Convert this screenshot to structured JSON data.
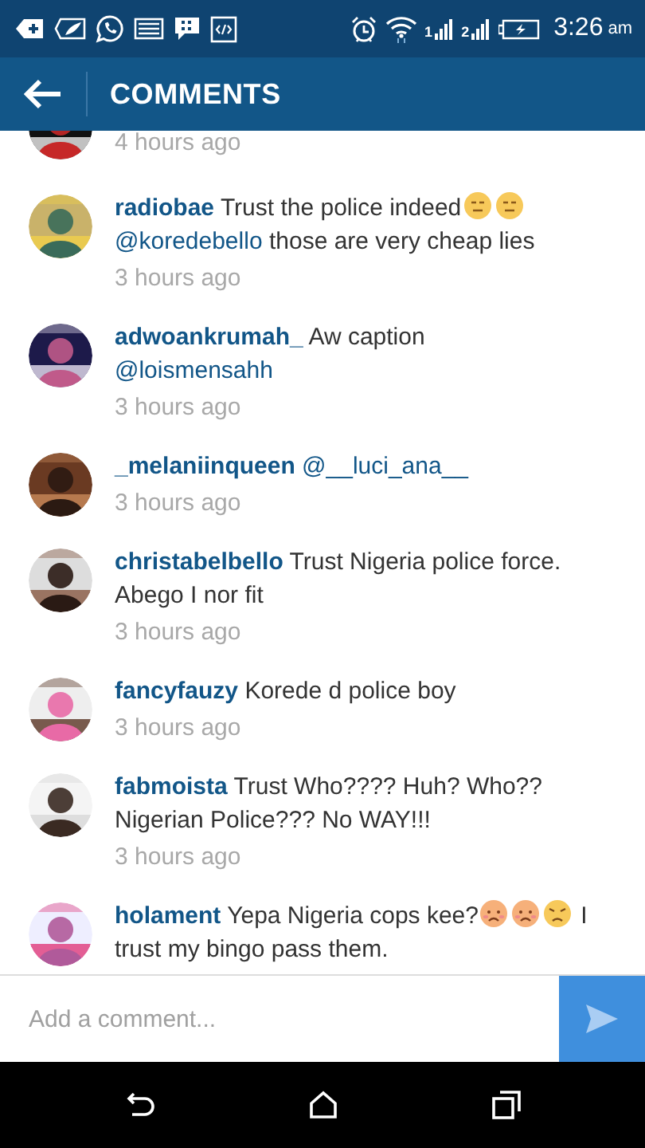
{
  "status_bar": {
    "sim_labels": [
      "1",
      "2"
    ],
    "time": "3:26",
    "time_suffix": "am"
  },
  "header": {
    "title": "COMMENTS"
  },
  "comments": [
    {
      "time": "4 hours ago"
    },
    {
      "username": "radiobae",
      "parts": [
        {
          "kind": "text",
          "text": "Trust the police indeed"
        },
        {
          "kind": "expressionless"
        },
        {
          "kind": "expressionless"
        },
        {
          "kind": "mention",
          "text": "@koredebello"
        },
        {
          "kind": "text",
          "text": " those are very cheap lies"
        }
      ],
      "time": "3 hours ago"
    },
    {
      "username": "adwoankrumah_",
      "parts": [
        {
          "kind": "text",
          "text": "Aw caption "
        },
        {
          "kind": "mention",
          "text": "@loismensahh"
        }
      ],
      "time": "3 hours ago"
    },
    {
      "username": "_melaniinqueen",
      "parts": [
        {
          "kind": "mention",
          "text": "@__luci_ana__"
        }
      ],
      "time": "3 hours ago"
    },
    {
      "username": "christabelbello",
      "parts": [
        {
          "kind": "text",
          "text": "Trust Nigeria police force. Abego I nor fit"
        }
      ],
      "time": "3 hours ago"
    },
    {
      "username": "fancyfauzy",
      "parts": [
        {
          "kind": "text",
          "text": "Korede d police boy"
        }
      ],
      "time": "3 hours ago"
    },
    {
      "username": "fabmoista",
      "parts": [
        {
          "kind": "text",
          "text": "Trust Who???? Huh? Who?? Nigerian Police??? No WAY!!!"
        }
      ],
      "time": "3 hours ago"
    },
    {
      "username": "holament",
      "parts": [
        {
          "kind": "text",
          "text": "Yepa Nigeria cops kee?"
        },
        {
          "kind": "worried"
        },
        {
          "kind": "worried"
        },
        {
          "kind": "angry"
        },
        {
          "kind": "text",
          "text": " I trust my bingo pass them."
        }
      ]
    }
  ],
  "comment_input": {
    "placeholder": "Add a comment..."
  }
}
